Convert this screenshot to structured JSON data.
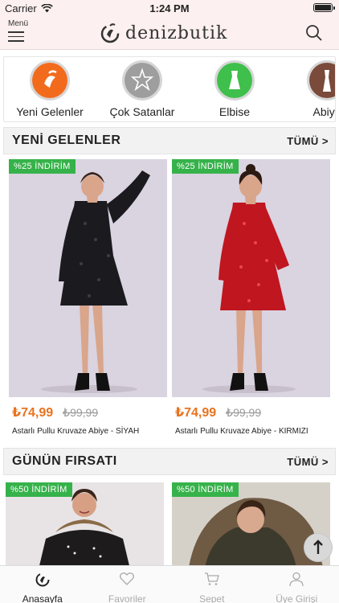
{
  "status": {
    "carrier": "Carrier",
    "time": "1:24 PM"
  },
  "header": {
    "menu_label": "Menü",
    "brand": "denizbutik"
  },
  "categories": [
    {
      "label": "Yeni Gelenler",
      "color": "#f26b1d"
    },
    {
      "label": "Çok Satanlar",
      "color": "#9e9e9e"
    },
    {
      "label": "Elbise",
      "color": "#3fbf4b"
    },
    {
      "label": "Abiye",
      "color": "#7a4a3a"
    }
  ],
  "sections": {
    "new_arrivals": {
      "title": "YENİ GELENLER",
      "all": "TÜMÜ >"
    },
    "deal_of_day": {
      "title": "GÜNÜN FIRSATI",
      "all": "TÜMÜ >"
    }
  },
  "new_products": [
    {
      "badge": "%25 İNDİRİM",
      "price": "₺74,99",
      "old_price": "₺99,99",
      "name": "Astarlı Pullu Kruvaze Abiye - SİYAH",
      "dress_color": "#1b1b1f"
    },
    {
      "badge": "%25 İNDİRİM",
      "price": "₺74,99",
      "old_price": "₺99,99",
      "name": "Astarlı Pullu Kruvaze Abiye - KIRMIZI",
      "dress_color": "#c0161f"
    }
  ],
  "deal_products": [
    {
      "badge": "%50 İNDİRİM",
      "jacket_color": "#1d1b1c"
    },
    {
      "badge": "%50 İNDİRİM",
      "jacket_color": "#3c3a2c"
    }
  ],
  "tabs": [
    {
      "label": "Anasayfa",
      "icon": "home-logo-icon",
      "active": true
    },
    {
      "label": "Favoriler",
      "icon": "heart-icon",
      "active": false
    },
    {
      "label": "Sepet",
      "icon": "cart-icon",
      "active": false
    },
    {
      "label": "Üye Girişi",
      "icon": "user-icon",
      "active": false
    }
  ]
}
